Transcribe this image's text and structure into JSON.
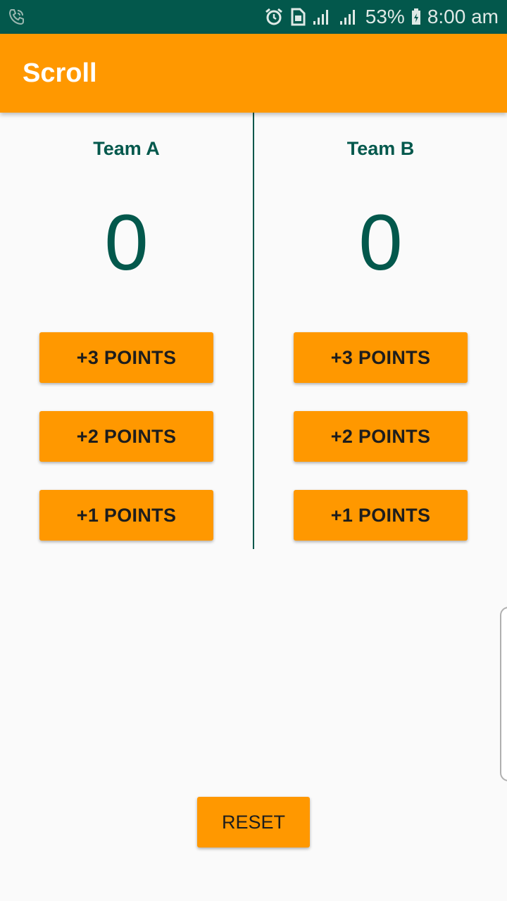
{
  "status_bar": {
    "battery": "53%",
    "time": "8:00 am",
    "icons": [
      "wifi-call-icon",
      "alarm-icon",
      "sim-icon",
      "signal-icon",
      "signal-icon",
      "battery-icon"
    ]
  },
  "app_bar": {
    "title": "Scroll"
  },
  "teams": [
    {
      "name": "Team A",
      "score": "0",
      "buttons": {
        "plus3": "+3 POINTS",
        "plus2": "+2 POINTS",
        "plus1": "+1 POINTS"
      }
    },
    {
      "name": "Team B",
      "score": "0",
      "buttons": {
        "plus3": "+3 POINTS",
        "plus2": "+2 POINTS",
        "plus1": "+1 POINTS"
      }
    }
  ],
  "reset_label": "RESET",
  "colors": {
    "status_bar": "#03584c",
    "accent": "#ff9800",
    "team_text": "#03584c",
    "background": "#fafafa"
  }
}
